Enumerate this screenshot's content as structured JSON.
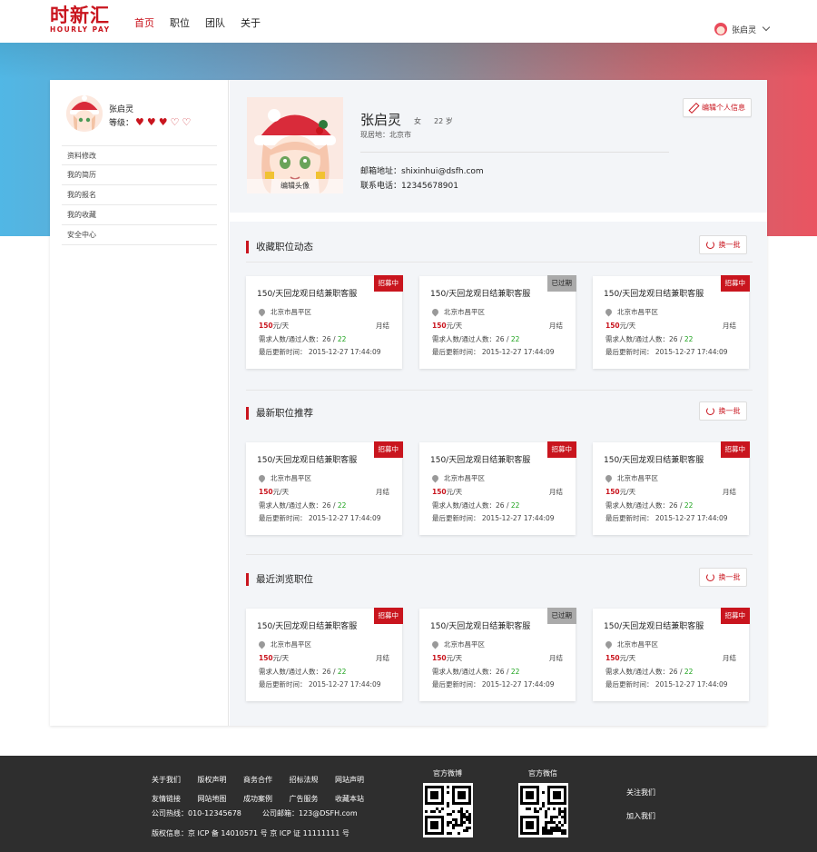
{
  "header": {
    "logo_cn": "时新汇",
    "logo_en": "HOURLY PAY",
    "nav": [
      "首页",
      "职位",
      "团队",
      "关于"
    ],
    "user_name": "张启灵"
  },
  "sidebar": {
    "name": "张启灵",
    "level_label": "等级：",
    "level": {
      "filled": 3,
      "total": 5
    },
    "menu": [
      "资料修改",
      "我的简历",
      "我的报名",
      "我的收藏",
      "安全中心"
    ]
  },
  "profile": {
    "name": "张启灵",
    "gender": "女",
    "age": "22 岁",
    "address": "现居地：北京市",
    "email": "邮箱地址：shixinhui@dsfh.com",
    "phone": "联系电话：12345678901",
    "edit_button": "编辑个人信息",
    "edit_avatar": "编辑头像"
  },
  "sections": [
    {
      "title": "收藏职位动态",
      "button": "换一批",
      "jobs": [
        {
          "title": "150/天回龙观日结兼职客服",
          "tag": "招募中",
          "status": "active",
          "location": "北京市昌平区",
          "pay": "150",
          "pay_unit": "元/天",
          "settle": "月结",
          "need_label": "需求人数/通过人数：26 / ",
          "passed": "22",
          "update": "最后更新时间： 2015-12-27   17:44:09"
        },
        {
          "title": "150/天回龙观日结兼职客服",
          "tag": "已过期",
          "status": "expired",
          "location": "北京市昌平区",
          "pay": "150",
          "pay_unit": "元/天",
          "settle": "月结",
          "need_label": "需求人数/通过人数：26 / ",
          "passed": "22",
          "update": "最后更新时间： 2015-12-27   17:44:09"
        },
        {
          "title": "150/天回龙观日结兼职客服",
          "tag": "招募中",
          "status": "active",
          "location": "北京市昌平区",
          "pay": "150",
          "pay_unit": "元/天",
          "settle": "月结",
          "need_label": "需求人数/通过人数：26 / ",
          "passed": "22",
          "update": "最后更新时间： 2015-12-27   17:44:09"
        }
      ]
    },
    {
      "title": "最新职位推荐",
      "button": "换一批",
      "jobs": [
        {
          "title": "150/天回龙观日结兼职客服",
          "tag": "招募中",
          "status": "active",
          "location": "北京市昌平区",
          "pay": "150",
          "pay_unit": "元/天",
          "settle": "月结",
          "need_label": "需求人数/通过人数：26 / ",
          "passed": "22",
          "update": "最后更新时间： 2015-12-27   17:44:09"
        },
        {
          "title": "150/天回龙观日结兼职客服",
          "tag": "招募中",
          "status": "active",
          "location": "北京市昌平区",
          "pay": "150",
          "pay_unit": "元/天",
          "settle": "月结",
          "need_label": "需求人数/通过人数：26 / ",
          "passed": "22",
          "update": "最后更新时间： 2015-12-27   17:44:09"
        },
        {
          "title": "150/天回龙观日结兼职客服",
          "tag": "招募中",
          "status": "active",
          "location": "北京市昌平区",
          "pay": "150",
          "pay_unit": "元/天",
          "settle": "月结",
          "need_label": "需求人数/通过人数：26 / ",
          "passed": "22",
          "update": "最后更新时间： 2015-12-27   17:44:09"
        }
      ]
    },
    {
      "title": "最近浏览职位",
      "button": "换一批",
      "jobs": [
        {
          "title": "150/天回龙观日结兼职客服",
          "tag": "招募中",
          "status": "active",
          "location": "北京市昌平区",
          "pay": "150",
          "pay_unit": "元/天",
          "settle": "月结",
          "need_label": "需求人数/通过人数：26 / ",
          "passed": "22",
          "update": "最后更新时间： 2015-12-27   17:44:09"
        },
        {
          "title": "150/天回龙观日结兼职客服",
          "tag": "已过期",
          "status": "expired",
          "location": "北京市昌平区",
          "pay": "150",
          "pay_unit": "元/天",
          "settle": "月结",
          "need_label": "需求人数/通过人数：26 / ",
          "passed": "22",
          "update": "最后更新时间： 2015-12-27   17:44:09"
        },
        {
          "title": "150/天回龙观日结兼职客服",
          "tag": "招募中",
          "status": "active",
          "location": "北京市昌平区",
          "pay": "150",
          "pay_unit": "元/天",
          "settle": "月结",
          "need_label": "需求人数/通过人数：26 / ",
          "passed": "22",
          "update": "最后更新时间： 2015-12-27   17:44:09"
        }
      ]
    }
  ],
  "footer": {
    "links_row1": [
      "关于我们",
      "版权声明",
      "商务合作",
      "招标法规",
      "网站声明"
    ],
    "links_row2": [
      "友情链接",
      "网站地图",
      "成功案例",
      "广告服务",
      "收藏本站"
    ],
    "hotline": "公司热线：010-12345678",
    "email": "公司邮箱：123@DSFH.com",
    "copyright": "版权信息：京 ICP 备 14010571 号 京 ICP 证 11111111 号",
    "weibo_label": "官方微博",
    "wechat_label": "官方微信",
    "follow": "关注我们",
    "join": "加入我们"
  },
  "colors": {
    "brand": "#c9151e",
    "pass": "#1ba21b",
    "expired_tag": "#aaaaaa"
  }
}
